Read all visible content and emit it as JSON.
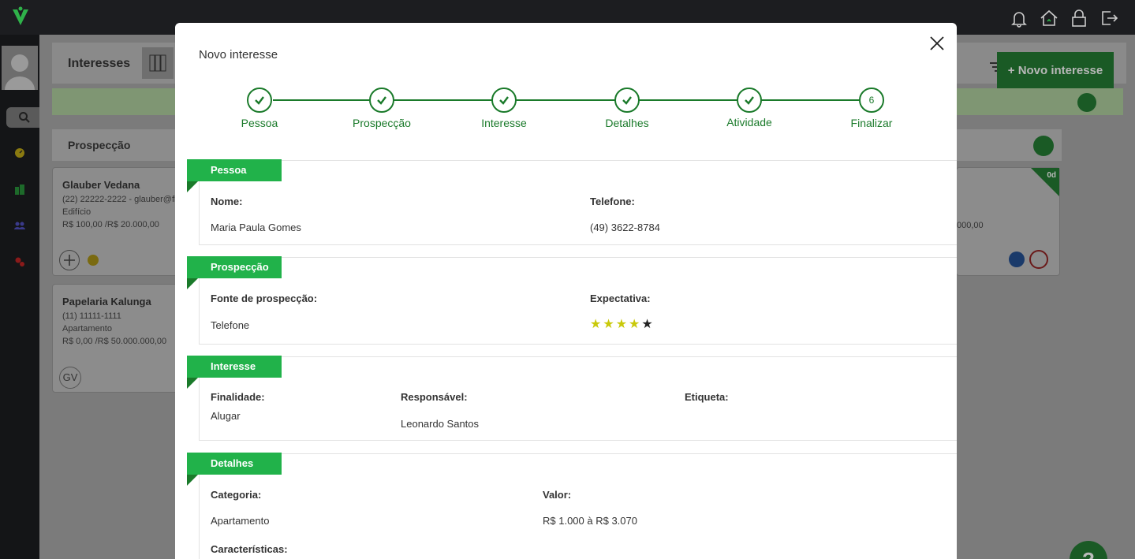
{
  "background": {
    "header_title": "Interesses",
    "new_button_label": "Novo interesse",
    "column_title": "Prospecção",
    "cards": [
      {
        "name": "Glauber Vedana",
        "contact": "(22) 22222-2222 - glauber@fle",
        "type": "Edifício",
        "range": "R$ 100,00 /R$ 20.000,00"
      },
      {
        "name": "Papelaria Kalunga",
        "contact": "(11) 11111-1111",
        "type": "Apartamento",
        "range": "R$ 0,00 /R$ 50.000.000,00",
        "initials": "GV"
      }
    ],
    "right_card_days": "0d",
    "right_card_value": "000,00"
  },
  "modal": {
    "title": "Novo interesse",
    "steps": [
      {
        "label": "Pessoa",
        "done": true
      },
      {
        "label": "Prospecção",
        "done": true
      },
      {
        "label": "Interesse",
        "done": true
      },
      {
        "label": "Detalhes",
        "done": true
      },
      {
        "label": "Atividade",
        "done": true
      },
      {
        "label": "Finalizar",
        "done": false,
        "number": "6"
      }
    ],
    "pessoa": {
      "tag": "Pessoa",
      "nome_label": "Nome:",
      "nome_value": "Maria Paula Gomes",
      "telefone_label": "Telefone:",
      "telefone_value": "(49) 3622-8784"
    },
    "prospeccao": {
      "tag": "Prospecção",
      "fonte_label": "Fonte de prospecção:",
      "fonte_value": "Telefone",
      "expectativa_label": "Expectativa:",
      "expectativa_rating": 4,
      "expectativa_max": 5
    },
    "interesse": {
      "tag": "Interesse",
      "finalidade_label": "Finalidade:",
      "finalidade_value": "Alugar",
      "responsavel_label": "Responsável:",
      "responsavel_value": "Leonardo Santos",
      "etiqueta_label": "Etiqueta:"
    },
    "detalhes": {
      "tag": "Detalhes",
      "categoria_label": "Categoria:",
      "categoria_value": "Apartamento",
      "valor_label": "Valor:",
      "valor_value": "R$ 1.000 à R$ 3.070",
      "caracteristicas_label": "Características:"
    }
  },
  "help_label": "?",
  "colors": {
    "accent_green": "#21b24a",
    "dark_green": "#1a7a2a",
    "star_filled": "#c9c90a",
    "star_empty": "#222222"
  }
}
